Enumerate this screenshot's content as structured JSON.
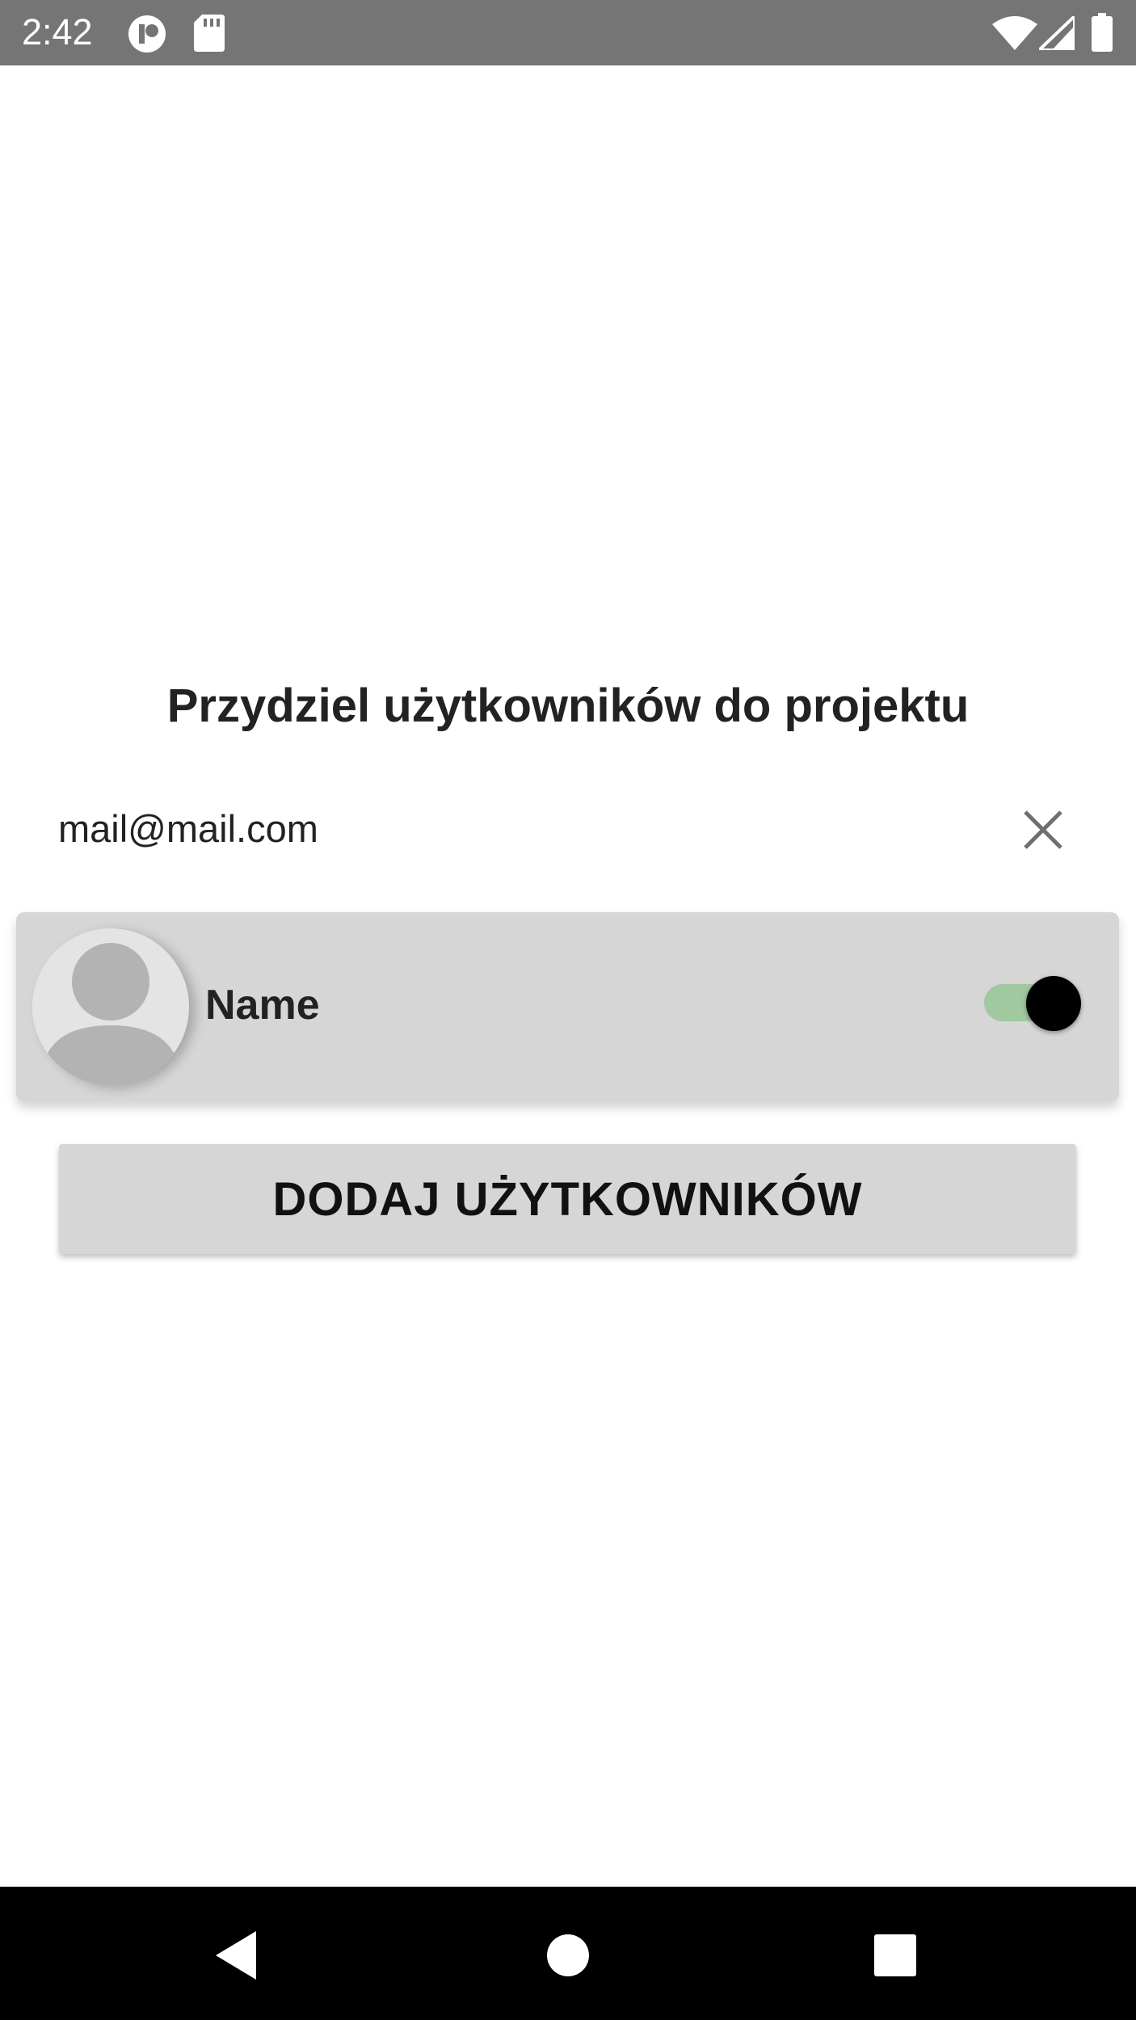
{
  "status_bar": {
    "time": "2:42",
    "icons": [
      "notification-app-icon",
      "sd-card-icon",
      "wifi-icon",
      "signal-icon",
      "battery-icon"
    ]
  },
  "dialog": {
    "title": "Przydziel użytkowników do projektu",
    "search": {
      "value": "mail@mail.com",
      "placeholder": "",
      "clear_icon": "close-icon"
    },
    "results": [
      {
        "name": "Name",
        "avatar_icon": "default-avatar-icon",
        "selected": true
      }
    ],
    "submit_label": "DODAJ UŻYTKOWNIKÓW"
  },
  "nav_bar": {
    "buttons": [
      "back-icon",
      "home-icon",
      "recents-icon"
    ]
  },
  "colors": {
    "status_bar": "#757575",
    "card_background": "#d6d6d6",
    "toggle_track_on": "#a1c9a0",
    "toggle_thumb": "#000000",
    "nav_bar": "#000000"
  }
}
